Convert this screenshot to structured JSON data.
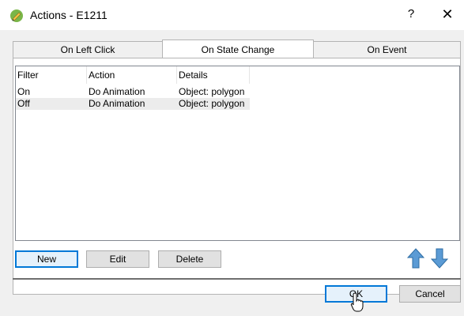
{
  "window": {
    "title": "Actions - E1211",
    "help_label": "?",
    "close_label": "✕",
    "icon": "app-pencil-icon"
  },
  "tabs": [
    {
      "label": "On Left Click",
      "active": false
    },
    {
      "label": "On State Change",
      "active": true
    },
    {
      "label": "On Event",
      "active": false
    }
  ],
  "table": {
    "columns": [
      "Filter",
      "Action",
      "Details"
    ],
    "rows": [
      {
        "filter": "On",
        "action": "Do Animation",
        "details": "Object: polygon"
      },
      {
        "filter": "Off",
        "action": "Do Animation",
        "details": "Object: polygon"
      }
    ]
  },
  "buttons": {
    "new": "New",
    "edit": "Edit",
    "delete": "Delete",
    "ok": "OK",
    "cancel": "Cancel"
  },
  "icons": {
    "move_up": "arrow-up-icon",
    "move_down": "arrow-down-icon"
  },
  "colors": {
    "accent": "#0078d7",
    "arrow": "#5b9bd5"
  }
}
